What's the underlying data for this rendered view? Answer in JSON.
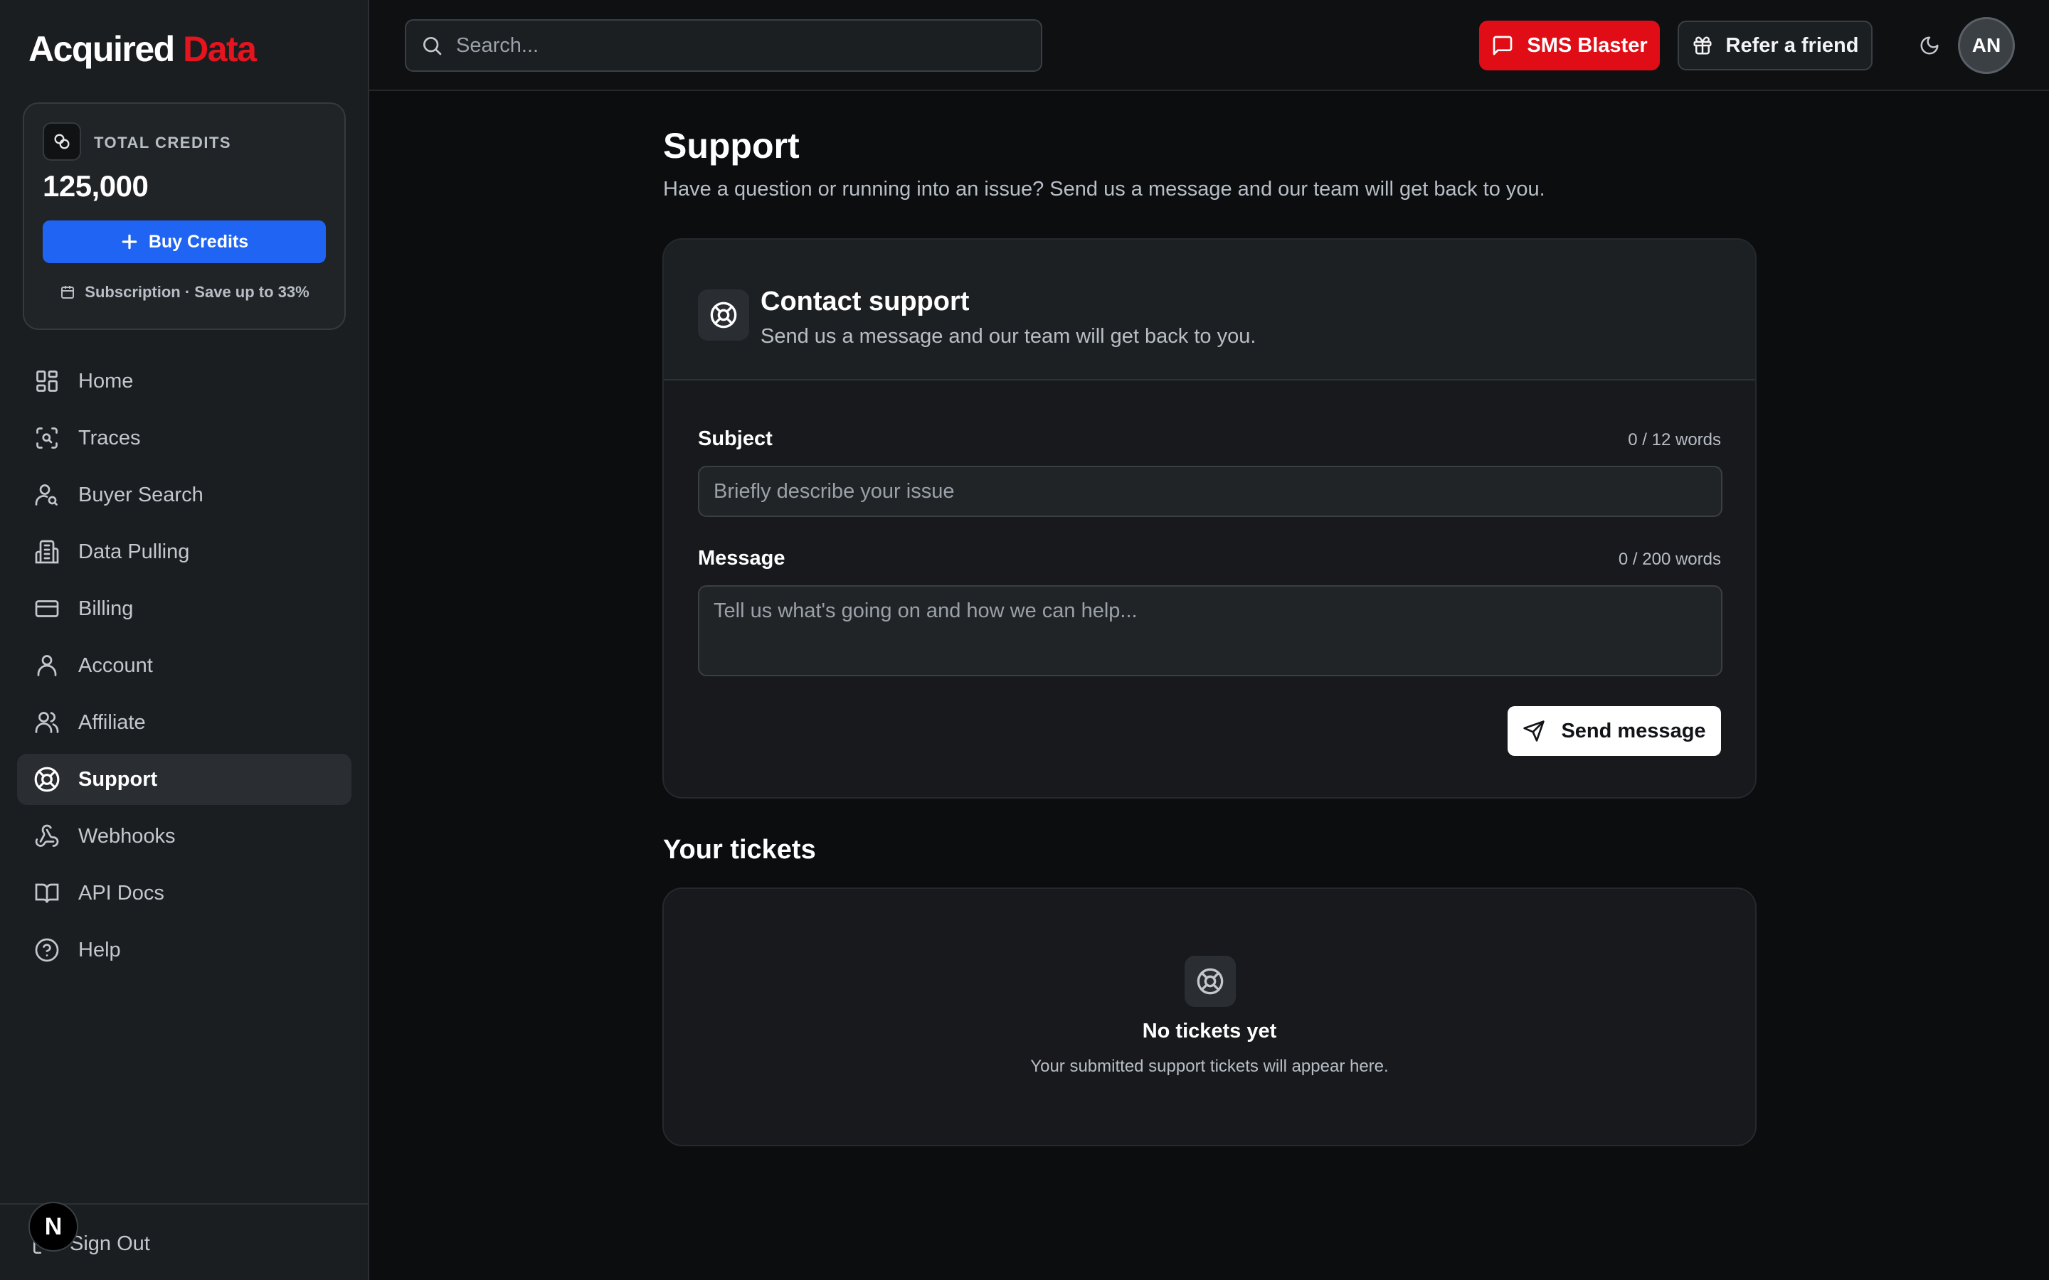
{
  "brand": {
    "name_primary": "Acquired",
    "name_accent": "Data",
    "accent_color": "#e6141e"
  },
  "credits": {
    "label": "TOTAL CREDITS",
    "value": "125,000",
    "buy_label": "Buy Credits",
    "subscription_text": "Subscription · Save up to 33%"
  },
  "sidebar": {
    "items": [
      {
        "label": "Home",
        "icon": "grid-icon"
      },
      {
        "label": "Traces",
        "icon": "scan-search-icon"
      },
      {
        "label": "Buyer Search",
        "icon": "user-search-icon"
      },
      {
        "label": "Data Pulling",
        "icon": "building-icon"
      },
      {
        "label": "Billing",
        "icon": "credit-card-icon"
      },
      {
        "label": "Account",
        "icon": "user-icon"
      },
      {
        "label": "Affiliate",
        "icon": "users-icon"
      },
      {
        "label": "Support",
        "icon": "life-buoy-icon",
        "active": true
      },
      {
        "label": "Webhooks",
        "icon": "webhook-icon"
      },
      {
        "label": "API Docs",
        "icon": "book-icon"
      },
      {
        "label": "Help",
        "icon": "help-circle-icon"
      }
    ],
    "signout_label": "Sign Out",
    "badge_letter": "N"
  },
  "topbar": {
    "search_placeholder": "Search...",
    "sms_label": "SMS Blaster",
    "refer_label": "Refer a friend",
    "avatar_initials": "AN",
    "sms_color": "#e00d17"
  },
  "main": {
    "title": "Support",
    "subtitle": "Have a question or running into an issue? Send us a message and our team will get back to you.",
    "contact": {
      "title": "Contact support",
      "subtitle": "Send us a message and our team will get back to you.",
      "subject_label": "Subject",
      "subject_count": "0 / 12 words",
      "subject_placeholder": "Briefly describe your issue",
      "message_label": "Message",
      "message_count": "0 / 200 words",
      "message_placeholder": "Tell us what's going on and how we can help...",
      "send_label": "Send message"
    },
    "tickets": {
      "title": "Your tickets",
      "empty_title": "No tickets yet",
      "empty_subtitle": "Your submitted support tickets will appear here."
    }
  }
}
